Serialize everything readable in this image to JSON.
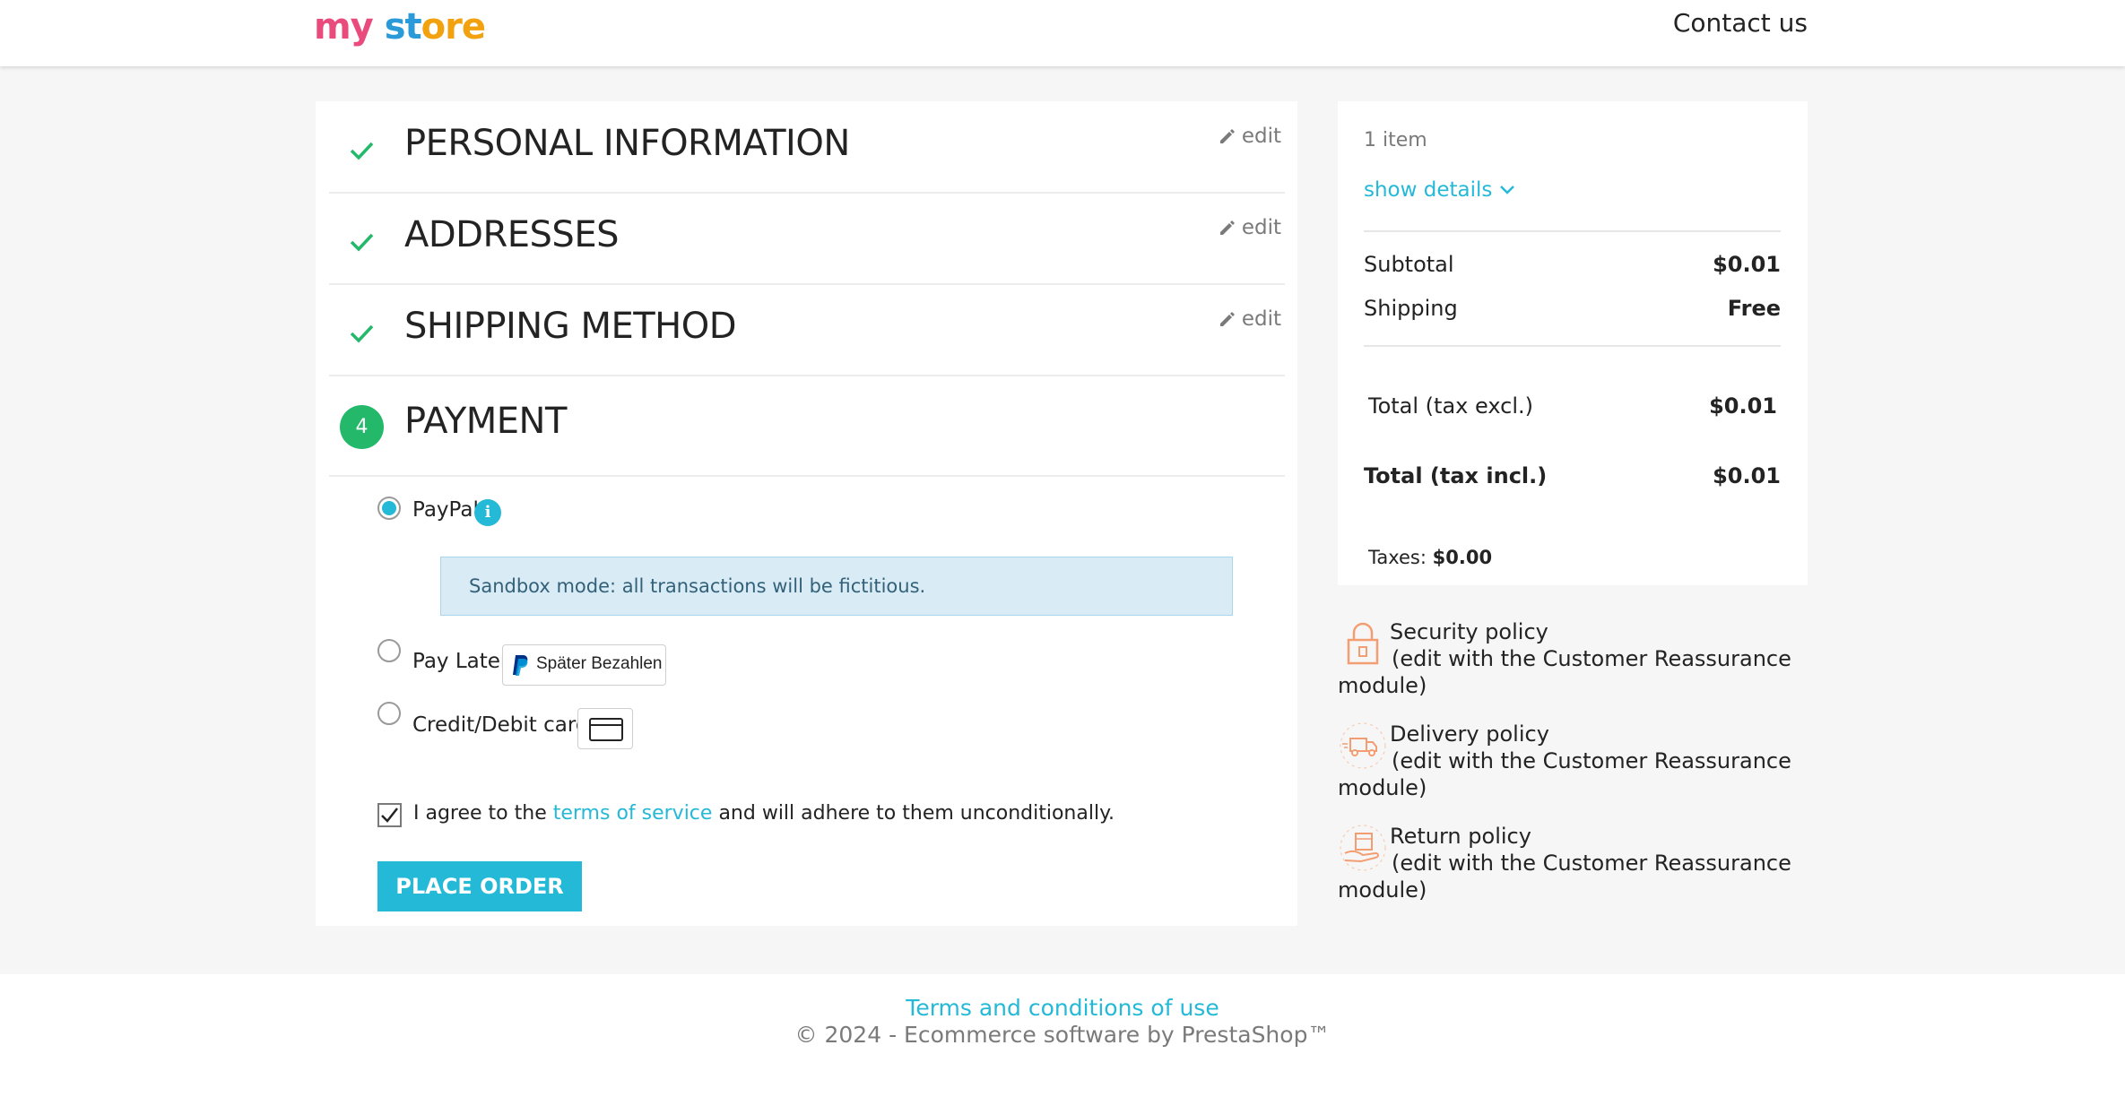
{
  "header": {
    "logo_parts": [
      "my",
      " ",
      "st",
      "ore"
    ],
    "contact": "Contact us"
  },
  "steps": [
    {
      "title": "PERSONAL INFORMATION",
      "edit": "edit"
    },
    {
      "title": "ADDRESSES",
      "edit": "edit"
    },
    {
      "title": "SHIPPING METHOD",
      "edit": "edit"
    },
    {
      "number": "4",
      "title": "PAYMENT"
    }
  ],
  "payment": {
    "options": [
      {
        "label": "PayPal",
        "selected": true
      },
      {
        "label": "Pay Later",
        "badge": "Später Bezahlen",
        "selected": false
      },
      {
        "label": "Credit/Debit card",
        "selected": false
      }
    ],
    "sandbox_notice": "Sandbox mode: all transactions will be fictitious.",
    "agree_prefix": "I agree to the ",
    "agree_link": "terms of service",
    "agree_suffix": " and will adhere to them unconditionally.",
    "agree_checked": true,
    "place_order": "PLACE ORDER"
  },
  "summary": {
    "items": "1 item",
    "show_details": "show details",
    "subtotal_label": "Subtotal",
    "subtotal_value": "$0.01",
    "shipping_label": "Shipping",
    "shipping_value": "Free",
    "total_excl_label": "Total (tax excl.)",
    "total_excl_value": "$0.01",
    "total_incl_label": "Total (tax incl.)",
    "total_incl_value": "$0.01",
    "taxes_label": "Taxes:",
    "taxes_value": "$0.00"
  },
  "reassurance": [
    {
      "title": "Security policy",
      "desc1": "(edit with the Customer Reassurance",
      "desc2": "module)",
      "icon": "lock-icon"
    },
    {
      "title": "Delivery policy",
      "desc1": "(edit with the Customer Reassurance",
      "desc2": "module)",
      "icon": "delivery-truck-icon"
    },
    {
      "title": "Return policy",
      "desc1": "(edit with the Customer Reassurance",
      "desc2": "module)",
      "icon": "return-box-icon"
    }
  ],
  "footer": {
    "terms": "Terms and conditions of use",
    "copyright": "© 2024 - Ecommerce software by PrestaShop™"
  },
  "colors": {
    "accent": "#24b9d7",
    "success": "#24b96a",
    "reassurance_icon": "#f39d72"
  }
}
